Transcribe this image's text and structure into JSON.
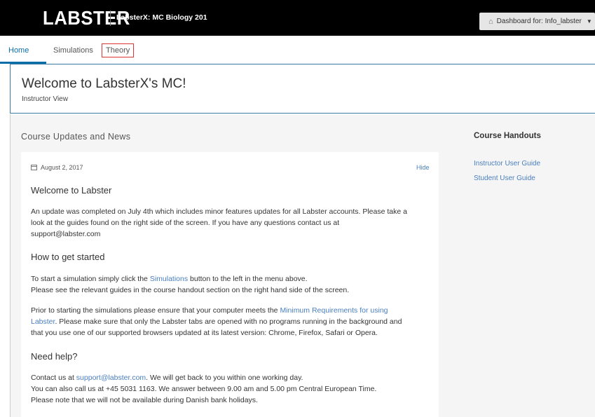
{
  "header": {
    "logo": "LABSTER",
    "course_title": "LabsterX: MC Biology 201",
    "dashboard_label": "Dashboard for: Info_labster"
  },
  "tabs": [
    {
      "label": "Home"
    },
    {
      "label": "Simulations"
    },
    {
      "label": "Theory"
    }
  ],
  "welcome": {
    "title": "Welcome to LabsterX's MC!",
    "subtitle": "Instructor View"
  },
  "updates": {
    "heading": "Course Updates and News",
    "date": "August 2, 2017",
    "hide_label": "Hide",
    "section1_title": "Welcome to Labster",
    "section1_line1": "An update was completed on July 4th which includes minor features updates for all Labster accounts. Please take a",
    "section1_line2": "look at the guides found on the right side of the screen. If you have any questions contact us at",
    "section1_line3": "support@labster.com",
    "section2_title": "How to get started",
    "section2_p1_pre": "To start a simulation simply click the ",
    "section2_p1_link": "Simulations",
    "section2_p1_post": " button to the left in the menu above.",
    "section2_p2": "Please see the relevant guides in the course handout section on the right hand side of the screen.",
    "section2_p3_pre": "Prior to starting the simulations please ensure that your computer meets the ",
    "section2_p3_link1": "Minimum Requirements for using",
    "section2_p3_link2": "Labster",
    "section2_p3_post1": ". Please make sure that only the Labster tabs are opened with no programs running in the background and",
    "section2_p3_post2": "that you use one of our supported browsers updated at its latest version: Chrome, Firefox, Safari or Opera.",
    "section3_title": "Need help?",
    "section3_p1_pre": "Contact us at ",
    "section3_p1_link": "support@labster.com",
    "section3_p1_post": ". We will get back to you within one working day.",
    "section3_p2": "You can also call us at +45 5031 1163. We answer between 9.00 am and 5.00 pm Central European Time.",
    "section3_p3": "Please note that we will not be available during Danish bank holidays."
  },
  "handouts": {
    "title": "Course Handouts",
    "links": [
      {
        "label": "Instructor User Guide"
      },
      {
        "label": "Student User Guide"
      }
    ]
  },
  "colors": {
    "accent": "#0c6ea8",
    "link": "#4a7fbf",
    "theory_highlight": "#dd3333"
  }
}
